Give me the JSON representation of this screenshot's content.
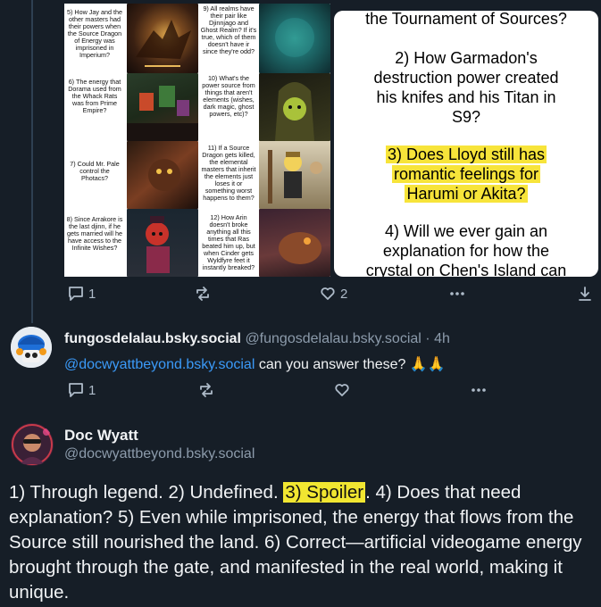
{
  "colors": {
    "background": "#161e27",
    "accent_link": "#3b9af8",
    "muted_text": "#8c9bab",
    "highlight_yellow": "#f7e43a"
  },
  "image": {
    "collage_questions": [
      "5) How Jay and the other masters had their powers when the Source Dragon of Energy was imprisoned in Imperium?",
      "6) The energy that Dorama used from the Whack Rats was from Prime Empire?",
      "7) Could Mr. Pale control the Photacs?",
      "8) Since Arrakore is the last djinn, if he gets married will he have access to the Infinite Wishes?",
      "9) All realms have their pair like Djinnjago and Ghost Realm? If it's true, which of them doesn't have ir since they're odd?",
      "10) What's the power source from things that aren't elements (wishes, dark magic, ghost powers, etc)?",
      "11) If a Source Dragon gets killed, the elemental masters that inherit the elements just loses it or something worst happens to them?",
      "12) How Arin doesn't broke anything all this times that Ras beated him up, but when Cinder gets Wyldfyre feet it instantly breaked?"
    ],
    "textcard": {
      "line_top": "the Tournament of Sources?",
      "q2": [
        "2) How Garmadon's",
        "destruction power created",
        "his knifes and his Titan in",
        "S9?"
      ],
      "q3": [
        "3) Does Lloyd still has",
        "romantic feelings for",
        "Harumi or Akita?"
      ],
      "q4": [
        "4) Will we ever gain an",
        "explanation for how the",
        "crystal on Chen's Island can"
      ]
    }
  },
  "post1_actions": {
    "reply_count": "1",
    "like_count": "2"
  },
  "post2": {
    "display_name": "fungosdelalau.bsky.social",
    "handle": "@fungosdelalau.bsky.social",
    "separator": "·",
    "time": "4h",
    "mention": "@docwyattbeyond.bsky.social",
    "text": "can you answer these?",
    "emoji": "🙏🙏",
    "reply_count": "1"
  },
  "post3": {
    "display_name": "Doc Wyatt",
    "handle": "@docwyattbeyond.bsky.social",
    "text_before": "1) Through legend. 2) Undefined. ",
    "spoiler": "3) Spoiler",
    "text_after": ". 4) Does that need explanation? 5) Even while imprisoned, the energy that flows from the Source still nourished the land. 6) Correct—artificial videogame energy brought through the gate, and manifested in the real world, making it unique."
  },
  "icons": {
    "reply": "speech-bubble-icon",
    "repost": "repost-arrows-icon",
    "like": "heart-icon",
    "more": "ellipsis-icon",
    "download": "download-icon"
  }
}
